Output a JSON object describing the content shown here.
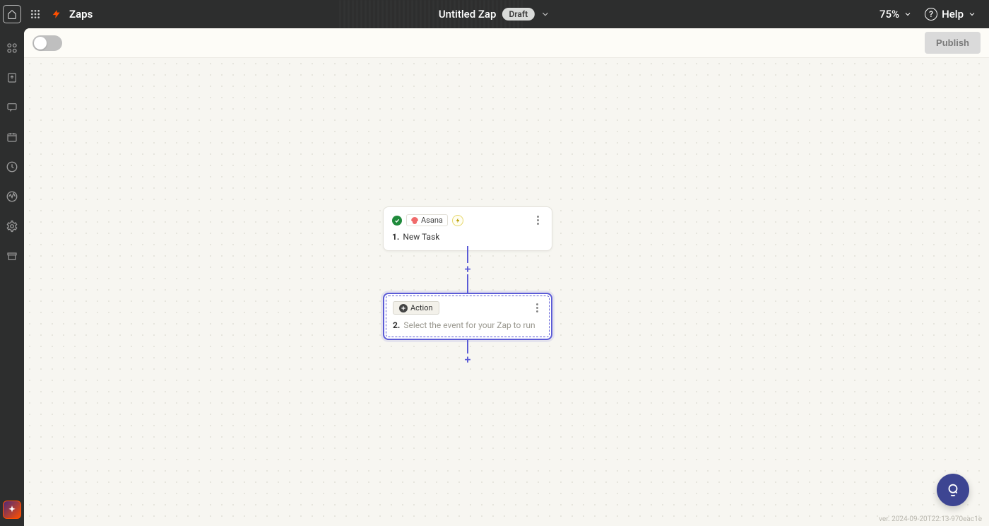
{
  "header": {
    "breadcrumb": "Zaps",
    "title": "Untitled Zap",
    "status_badge": "Draft",
    "zoom": "75%",
    "help_label": "Help"
  },
  "toolbar": {
    "publish_label": "Publish",
    "enabled": false
  },
  "steps": {
    "trigger": {
      "app_name": "Asana",
      "index": "1.",
      "title": "New Task"
    },
    "action": {
      "chip_label": "Action",
      "index": "2.",
      "placeholder": "Select the event for your Zap to run"
    }
  },
  "footer": {
    "version": "ver. 2024-09-20T22:13-970eac1e"
  }
}
